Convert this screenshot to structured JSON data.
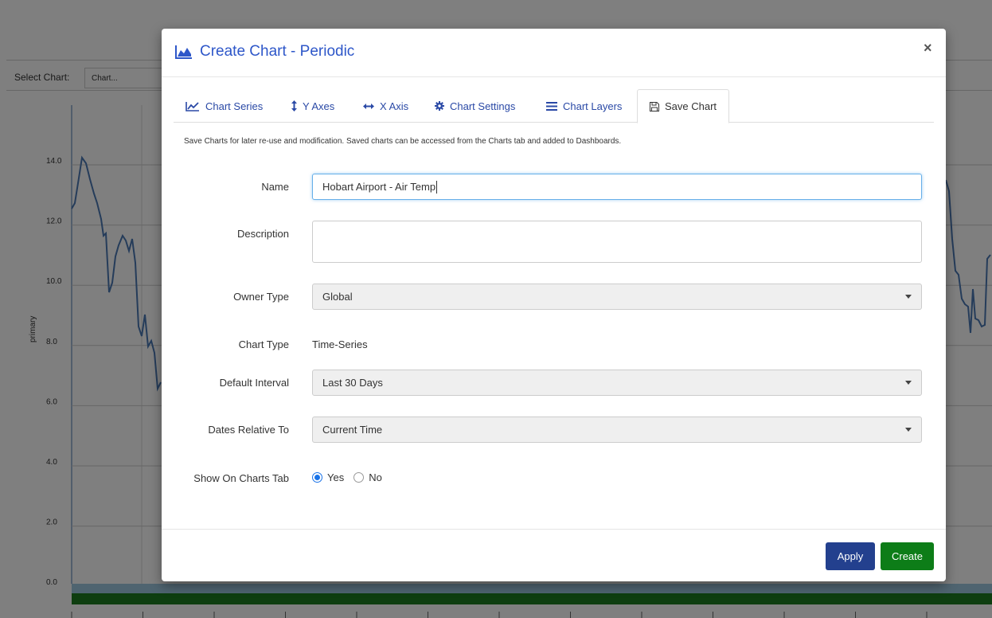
{
  "background": {
    "select_chart_label": "Select Chart:",
    "select_chart_value": "Chart...",
    "y_axis_label": "primary",
    "y_ticks": [
      "14.0",
      "12.0",
      "10.0",
      "8.0",
      "6.0",
      "4.0",
      "2.0",
      "0.0"
    ],
    "line_color": "#4a78b5",
    "band_colors": {
      "light": "#9ec9e0",
      "dark": "#1d7d20"
    }
  },
  "modal": {
    "title": "Create Chart - Periodic",
    "title_icon": "area-chart-icon",
    "close_label": "×",
    "tabs": [
      {
        "label": "Chart Series",
        "icon": "line-chart-icon"
      },
      {
        "label": "Y Axes",
        "icon": "vertical-arrows-icon"
      },
      {
        "label": "X Axis",
        "icon": "horizontal-arrows-icon"
      },
      {
        "label": "Chart Settings",
        "icon": "gear-icon"
      },
      {
        "label": "Chart Layers",
        "icon": "bars-icon"
      },
      {
        "label": "Save Chart",
        "icon": "floppy-disk-icon",
        "active": true
      }
    ],
    "intro": "Save Charts for later re-use and modification. Saved charts can be accessed from the Charts tab and added to Dashboards.",
    "form": {
      "name_label": "Name",
      "name_value": "Hobart Airport - Air Temp",
      "description_label": "Description",
      "description_value": "",
      "owner_type_label": "Owner Type",
      "owner_type_value": "Global",
      "chart_type_label": "Chart Type",
      "chart_type_value": "Time-Series",
      "default_interval_label": "Default Interval",
      "default_interval_value": "Last 30 Days",
      "dates_relative_label": "Dates Relative To",
      "dates_relative_value": "Current Time",
      "show_on_tab_label": "Show On Charts Tab",
      "show_yes": "Yes",
      "show_no": "No",
      "show_selected": "Yes"
    },
    "footer": {
      "apply_label": "Apply",
      "create_label": "Create"
    },
    "colors": {
      "accent": "#2e57c9",
      "apply": "#23408e",
      "create": "#0d7d18"
    }
  }
}
